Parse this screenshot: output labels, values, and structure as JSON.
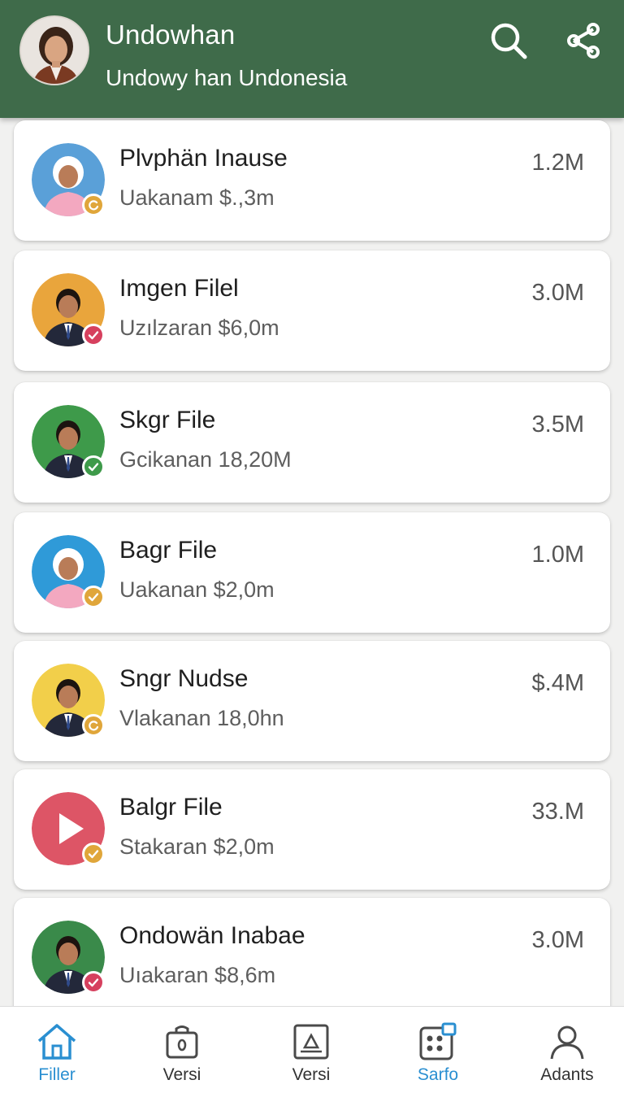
{
  "header": {
    "title": "Undowhan",
    "subtitle": "Undowy han Undonesia",
    "background": "#3f6b4a"
  },
  "files": [
    {
      "name": "Plvphän Inause",
      "detail": "Uakanam $.,3m",
      "size": "1.2M",
      "avatar_bg": "#5aa0d8",
      "badge_color": "#e0a63a",
      "badge_icon": "refresh-icon"
    },
    {
      "name": "Imgen Filel",
      "detail": "Uzılzaran $6,0m",
      "size": "3.0M",
      "avatar_bg": "#e9a53c",
      "badge_color": "#d6405e",
      "badge_icon": "check-icon"
    },
    {
      "name": "Skgr File",
      "detail": "Gcikanan 18,20M",
      "size": "3.5M",
      "avatar_bg": "#3e9a4a",
      "badge_color": "#3e9a4a",
      "badge_icon": "check-icon"
    },
    {
      "name": "Bagr File",
      "detail": "Uakanan $2,0m",
      "size": "1.0M",
      "avatar_bg": "#2f9ad8",
      "badge_color": "#e0a63a",
      "badge_icon": "check-icon"
    },
    {
      "name": "Sngr Nudse",
      "detail": "Vlakanan 18,0hn",
      "size": "$.4M",
      "avatar_bg": "#f2cf4a",
      "badge_color": "#e0a63a",
      "badge_icon": "refresh-icon"
    },
    {
      "name": "Balgr File",
      "detail": "Stakaran $2,0m",
      "size": "33.M",
      "avatar_bg": "#dd5566",
      "badge_color": "#e0a63a",
      "badge_icon": "check-icon"
    },
    {
      "name": "Ondowän Inabae",
      "detail": "Uıakaran $8,6m",
      "size": "3.0M",
      "avatar_bg": "#3a8a4a",
      "badge_color": "#d6405e",
      "badge_icon": "check-icon"
    }
  ],
  "nav": [
    {
      "label": "Filler",
      "icon": "home-icon",
      "active": true
    },
    {
      "label": "Versi",
      "icon": "bag-icon",
      "active": false
    },
    {
      "label": "Versi",
      "icon": "image-icon",
      "active": false
    },
    {
      "label": "Sarfo",
      "icon": "apps-icon",
      "active": true
    },
    {
      "label": "Adants",
      "icon": "person-icon",
      "active": false
    }
  ],
  "colors": {
    "accent": "#2a8fd1",
    "text_primary": "#1f1f1f",
    "text_secondary": "#5e5e5e"
  }
}
